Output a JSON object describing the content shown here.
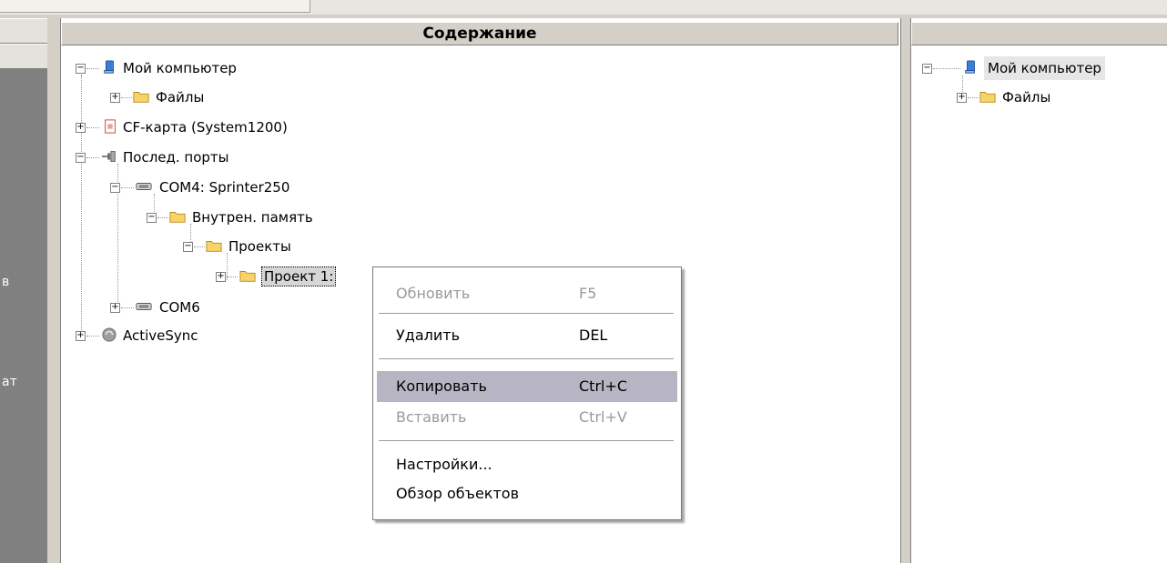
{
  "left_pane": {
    "label_1": "в",
    "label_2": "ат"
  },
  "content": {
    "header": "Содержание",
    "tree": {
      "my_computer": "Мой компьютер",
      "files": "Файлы",
      "cf_card": "CF-карта (System1200)",
      "serial_ports": "Послед. порты",
      "com4": "COM4: Sprinter250",
      "internal_memory": "Внутрен. память",
      "projects": "Проекты",
      "project1": "Проект 1:",
      "com6": "COM6",
      "activesync": "ActiveSync"
    }
  },
  "right_pane": {
    "header": "",
    "tree": {
      "my_computer": "Мой компьютер",
      "files": "Файлы"
    }
  },
  "context_menu": {
    "items": [
      {
        "label": "Обновить",
        "shortcut": "F5",
        "enabled": false
      },
      {
        "label": "Удалить",
        "shortcut": "DEL",
        "enabled": true
      },
      {
        "label": "Копировать",
        "shortcut": "Ctrl+C",
        "enabled": true,
        "highlighted": true
      },
      {
        "label": "Вставить",
        "shortcut": "Ctrl+V",
        "enabled": false
      },
      {
        "label": "Настройки...",
        "shortcut": "",
        "enabled": true
      },
      {
        "label": "Обзор объектов",
        "shortcut": "",
        "enabled": true
      }
    ]
  },
  "icons": {
    "computer": "computer-icon",
    "folder": "folder-icon",
    "card": "memory-card-icon",
    "port": "serial-port-icon",
    "device": "com-device-icon",
    "sync": "activesync-icon"
  },
  "colors": {
    "folder": "#f7d46a",
    "highlight": "#b7b5c4",
    "disabled_text": "#9a9a9a"
  }
}
